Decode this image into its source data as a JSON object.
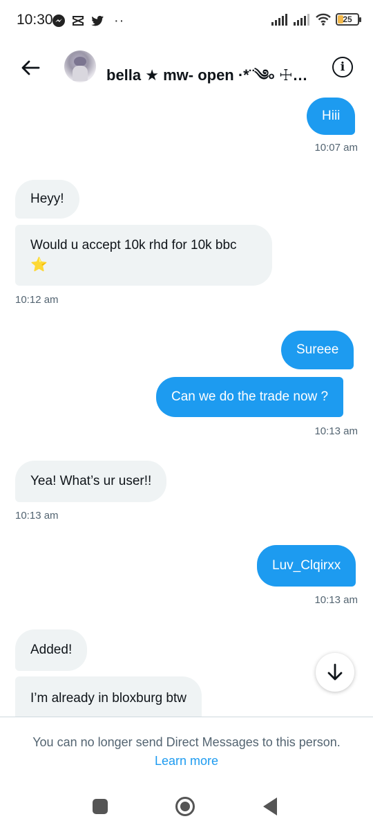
{
  "status_bar": {
    "time": "10:30",
    "battery": "25",
    "left_icons": [
      "messenger-icon",
      "capcut-icon",
      "twitter-icon"
    ],
    "more_indicator": "··"
  },
  "header": {
    "name": "bella ★ mw- open ·*¨༄৹ ☩…",
    "back_icon": "arrow-left-icon",
    "info_icon": "info-icon",
    "info_glyph": "i"
  },
  "messages": [
    {
      "dir": "out",
      "text": "Hiii"
    },
    {
      "ts": "10:07 am"
    },
    {
      "dir": "in",
      "text": "Heyy!"
    },
    {
      "dir": "in",
      "text": "Would u accept 10k rhd for 10k bbc",
      "emoji": "⭐"
    },
    {
      "ts": "10:12 am"
    },
    {
      "dir": "out",
      "text": "Sureee"
    },
    {
      "dir": "out",
      "text": "Can we do the trade now ?"
    },
    {
      "ts": "10:13 am"
    },
    {
      "dir": "in",
      "text": "Yea! What’s ur user!!"
    },
    {
      "ts": "10:13 am"
    },
    {
      "dir": "out",
      "text": "Luv_Clqirxx"
    },
    {
      "ts": "10:13 am"
    },
    {
      "dir": "in",
      "text": "Added!"
    },
    {
      "dir": "in",
      "text": "I’m already in bloxburg btw"
    }
  ],
  "footer": {
    "notice": "You can no longer send Direct Messages to this person.",
    "learn_more": "Learn more"
  },
  "colors": {
    "accent": "#1d9bf0",
    "incoming_bubble": "#eff3f4",
    "secondary_text": "#536471"
  }
}
